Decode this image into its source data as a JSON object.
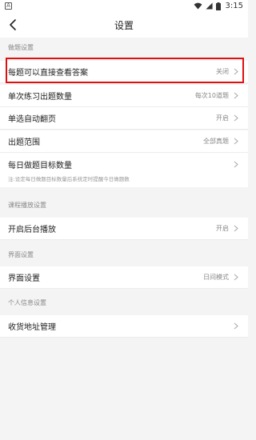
{
  "status_bar": {
    "left_icon": "A",
    "icons": [
      "wifi-icon",
      "signal-icon",
      "battery-icon"
    ],
    "time": "3:15"
  },
  "nav": {
    "title": "设置",
    "back_icon": "chevron-left-icon"
  },
  "sections": {
    "practice": {
      "header": "做题设置",
      "items": [
        {
          "label": "每题可以直接查看答案",
          "value": "关闭"
        },
        {
          "label": "单次练习出题数量",
          "value": "每次10道题"
        },
        {
          "label": "单选自动翻页",
          "value": "开启"
        },
        {
          "label": "出题范围",
          "value": "全部真题"
        },
        {
          "label": "每日做题目标数量",
          "value": ""
        }
      ],
      "note": "注:设定每日做题目标数量后系统定时提醒今日做题数"
    },
    "course": {
      "header": "课程播放设置",
      "items": [
        {
          "label": "开启后台播放",
          "value": "开启"
        }
      ]
    },
    "interface": {
      "header": "界面设置",
      "items": [
        {
          "label": "界面设置",
          "value": "日间模式"
        }
      ]
    },
    "personal": {
      "header": "个人信息设置",
      "items": [
        {
          "label": "收货地址管理",
          "value": ""
        }
      ]
    }
  },
  "colors": {
    "highlight": "#e01010",
    "background": "#f4f4f4",
    "row_background": "#ffffff"
  }
}
